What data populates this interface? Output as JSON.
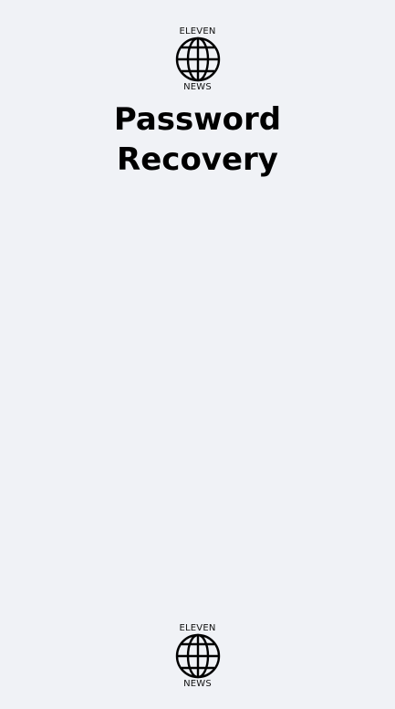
{
  "header": {
    "logo": {
      "top_text": "ELEVEN",
      "bottom_text": "NEWS",
      "icon": "globe-icon"
    },
    "title_line1": "Password",
    "title_line2": "Recovery"
  },
  "footer": {
    "logo": {
      "top_text": "ELEVEN",
      "bottom_text": "NEWS",
      "icon": "globe-icon"
    }
  },
  "colors": {
    "background": "#f0f2f6",
    "text": "#000000"
  }
}
